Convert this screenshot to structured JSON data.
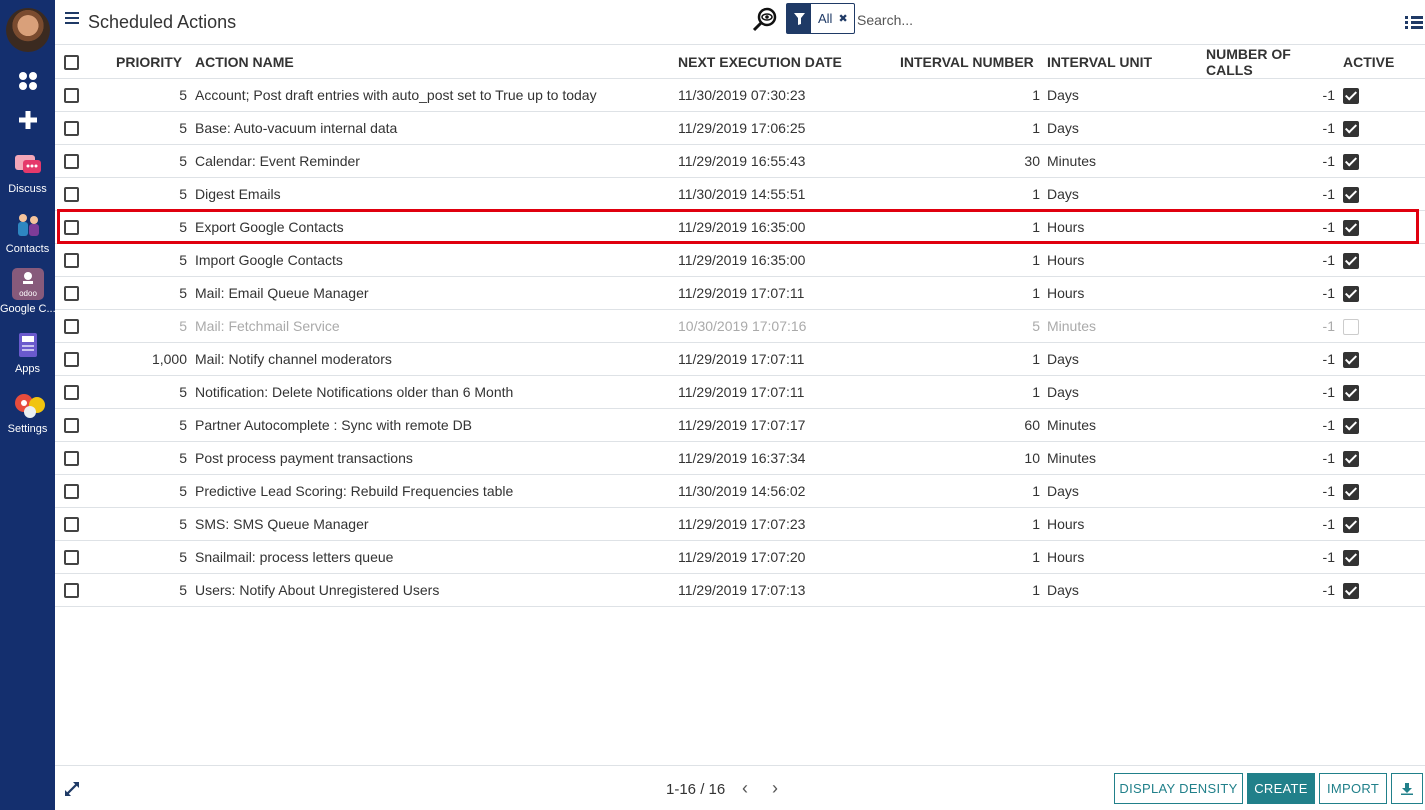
{
  "sidebar": {
    "apps": [
      {
        "label": "Discuss",
        "icon": "discuss-icon"
      },
      {
        "label": "Contacts",
        "icon": "contacts-icon"
      },
      {
        "label": "Google C...",
        "icon": "google-contacts-icon"
      },
      {
        "label": "Apps",
        "icon": "apps-icon"
      },
      {
        "label": "Settings",
        "icon": "settings-icon"
      }
    ]
  },
  "header": {
    "title": "Scheduled Actions",
    "facet_label": "All",
    "search_placeholder": "Search..."
  },
  "columns": {
    "priority": "PRIORITY",
    "name": "ACTION NAME",
    "next_date": "NEXT EXECUTION DATE",
    "interval_number": "INTERVAL NUMBER",
    "interval_unit": "INTERVAL UNIT",
    "calls": "NUMBER OF CALLS",
    "active": "ACTIVE"
  },
  "rows": [
    {
      "priority": "5",
      "name": "Account; Post draft entries with auto_post set to True up to today",
      "next_date": "11/30/2019 07:30:23",
      "interval_number": "1",
      "interval_unit": "Days",
      "calls": "-1",
      "active": true
    },
    {
      "priority": "5",
      "name": "Base: Auto-vacuum internal data",
      "next_date": "11/29/2019 17:06:25",
      "interval_number": "1",
      "interval_unit": "Days",
      "calls": "-1",
      "active": true
    },
    {
      "priority": "5",
      "name": "Calendar: Event Reminder",
      "next_date": "11/29/2019 16:55:43",
      "interval_number": "30",
      "interval_unit": "Minutes",
      "calls": "-1",
      "active": true
    },
    {
      "priority": "5",
      "name": "Digest Emails",
      "next_date": "11/30/2019 14:55:51",
      "interval_number": "1",
      "interval_unit": "Days",
      "calls": "-1",
      "active": true
    },
    {
      "priority": "5",
      "name": "Export Google Contacts",
      "next_date": "11/29/2019 16:35:00",
      "interval_number": "1",
      "interval_unit": "Hours",
      "calls": "-1",
      "active": true
    },
    {
      "priority": "5",
      "name": "Import Google Contacts",
      "next_date": "11/29/2019 16:35:00",
      "interval_number": "1",
      "interval_unit": "Hours",
      "calls": "-1",
      "active": true
    },
    {
      "priority": "5",
      "name": "Mail: Email Queue Manager",
      "next_date": "11/29/2019 17:07:11",
      "interval_number": "1",
      "interval_unit": "Hours",
      "calls": "-1",
      "active": true
    },
    {
      "priority": "5",
      "name": "Mail: Fetchmail Service",
      "next_date": "10/30/2019 17:07:16",
      "interval_number": "5",
      "interval_unit": "Minutes",
      "calls": "-1",
      "active": false
    },
    {
      "priority": "1,000",
      "name": "Mail: Notify channel moderators",
      "next_date": "11/29/2019 17:07:11",
      "interval_number": "1",
      "interval_unit": "Days",
      "calls": "-1",
      "active": true
    },
    {
      "priority": "5",
      "name": "Notification: Delete Notifications older than 6 Month",
      "next_date": "11/29/2019 17:07:11",
      "interval_number": "1",
      "interval_unit": "Days",
      "calls": "-1",
      "active": true
    },
    {
      "priority": "5",
      "name": "Partner Autocomplete : Sync with remote DB",
      "next_date": "11/29/2019 17:07:17",
      "interval_number": "60",
      "interval_unit": "Minutes",
      "calls": "-1",
      "active": true
    },
    {
      "priority": "5",
      "name": "Post process payment transactions",
      "next_date": "11/29/2019 16:37:34",
      "interval_number": "10",
      "interval_unit": "Minutes",
      "calls": "-1",
      "active": true
    },
    {
      "priority": "5",
      "name": "Predictive Lead Scoring: Rebuild Frequencies table",
      "next_date": "11/30/2019 14:56:02",
      "interval_number": "1",
      "interval_unit": "Days",
      "calls": "-1",
      "active": true
    },
    {
      "priority": "5",
      "name": "SMS: SMS Queue Manager",
      "next_date": "11/29/2019 17:07:23",
      "interval_number": "1",
      "interval_unit": "Hours",
      "calls": "-1",
      "active": true
    },
    {
      "priority": "5",
      "name": "Snailmail: process letters queue",
      "next_date": "11/29/2019 17:07:20",
      "interval_number": "1",
      "interval_unit": "Hours",
      "calls": "-1",
      "active": true
    },
    {
      "priority": "5",
      "name": "Users: Notify About Unregistered Users",
      "next_date": "11/29/2019 17:07:13",
      "interval_number": "1",
      "interval_unit": "Days",
      "calls": "-1",
      "active": true
    }
  ],
  "footer": {
    "pager": "1-16 / 16",
    "display_density": "DISPLAY DENSITY",
    "create": "CREATE",
    "import": "IMPORT"
  },
  "colors": {
    "sidebar_bg": "#142F6E",
    "accent": "#21808A",
    "highlight": "#E0000F"
  }
}
